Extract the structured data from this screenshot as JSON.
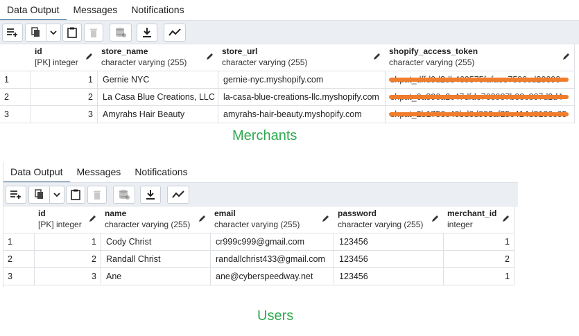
{
  "merchants_panel": {
    "tabs": [
      {
        "label": "Data Output",
        "active": true
      },
      {
        "label": "Messages",
        "active": false
      },
      {
        "label": "Notifications",
        "active": false
      }
    ],
    "columns": [
      {
        "name": "id",
        "type": "[PK] integer"
      },
      {
        "name": "store_name",
        "type": "character varying (255)"
      },
      {
        "name": "store_url",
        "type": "character varying (255)"
      },
      {
        "name": "shopify_access_token",
        "type": "character varying (255)"
      }
    ],
    "rows": [
      {
        "num": "1",
        "id": "1",
        "store_name": "Gernie NYC",
        "store_url": "gernie-nyc.myshopify.com",
        "token": "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"
      },
      {
        "num": "2",
        "id": "2",
        "store_name": "La Casa Blue Creations, LLC",
        "store_url": "la-casa-blue-creations-llc.myshopify.com",
        "token": "shpat_6a890a2c47dfde768987b88c887d2d4"
      },
      {
        "num": "3",
        "id": "3",
        "store_name": "Amyrahs Hair Beauty",
        "store_url": "amyrahs-hair-beauty.myshopify.com",
        "token": "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"
      }
    ],
    "caption": "Merchants"
  },
  "users_panel": {
    "tabs": [
      {
        "label": "Data Output",
        "active": true
      },
      {
        "label": "Messages",
        "active": false
      },
      {
        "label": "Notifications",
        "active": false
      }
    ],
    "columns": [
      {
        "name": "id",
        "type": "[PK] integer"
      },
      {
        "name": "name",
        "type": "character varying (255)"
      },
      {
        "name": "email",
        "type": "character varying (255)"
      },
      {
        "name": "password",
        "type": "character varying (255)"
      },
      {
        "name": "merchant_id",
        "type": "integer"
      }
    ],
    "rows": [
      {
        "num": "1",
        "id": "1",
        "name": "Cody Christ",
        "email": "cr999c999@gmail.com",
        "password": "123456",
        "merchant_id": "1"
      },
      {
        "num": "2",
        "id": "2",
        "name": "Randall Christ",
        "email": "randallchrist433@gmail.com",
        "password": "123456",
        "merchant_id": "2"
      },
      {
        "num": "3",
        "id": "3",
        "name": "Ane",
        "email": "ane@cyberspeedway.net",
        "password": "123456",
        "merchant_id": "1"
      }
    ],
    "caption": "Users"
  },
  "toolbar_icons": [
    "add-row-icon",
    "copy-icon",
    "chevron-down-icon",
    "paste-icon",
    "delete-icon",
    "save-data-icon",
    "download-icon",
    "graph-icon"
  ],
  "colors": {
    "active_tab": "#326690",
    "redaction": "#f07d2c",
    "caption": "#2fa84f",
    "toolbar_bg": "#ebeef3"
  }
}
